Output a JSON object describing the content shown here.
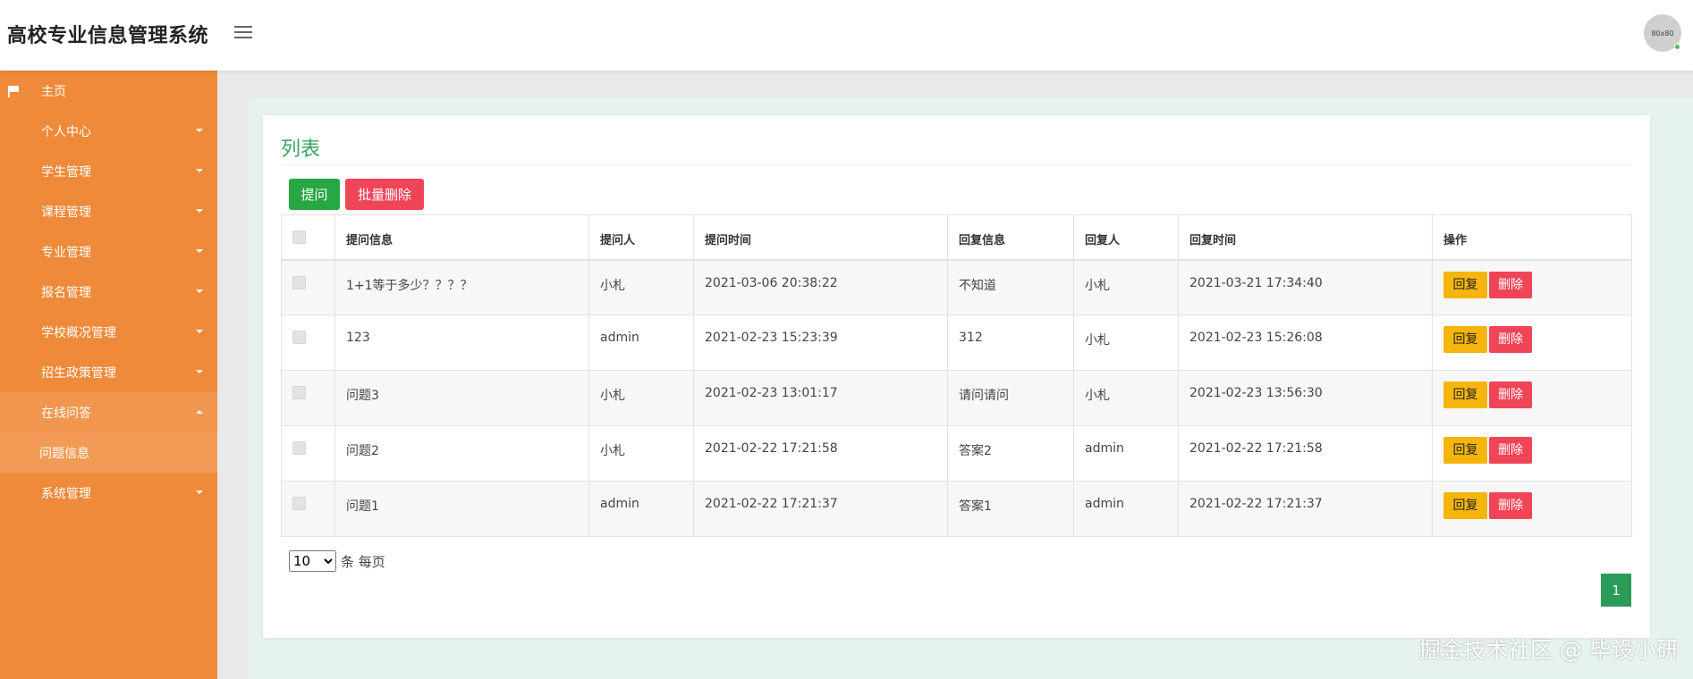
{
  "app": {
    "title": "高校专业信息管理系统",
    "avatar_text": "80x80"
  },
  "sidebar": {
    "items": [
      {
        "label": "主页",
        "icon": "flag-icon",
        "caret": ""
      },
      {
        "label": "个人中心",
        "icon": "grid-icon",
        "caret": "down"
      },
      {
        "label": "学生管理",
        "icon": "grid-icon",
        "caret": "down"
      },
      {
        "label": "课程管理",
        "icon": "grid-icon",
        "caret": "down"
      },
      {
        "label": "专业管理",
        "icon": "grid-icon",
        "caret": "down"
      },
      {
        "label": "报名管理",
        "icon": "grid-icon",
        "caret": "down"
      },
      {
        "label": "学校概况管理",
        "icon": "grid-icon",
        "caret": "down"
      },
      {
        "label": "招生政策管理",
        "icon": "grid-icon",
        "caret": "down"
      },
      {
        "label": "在线问答",
        "icon": "grid-icon",
        "caret": "up",
        "active": true
      },
      {
        "label": "系统管理",
        "icon": "grid-icon",
        "caret": "down"
      }
    ],
    "submenu": {
      "label": "问题信息"
    }
  },
  "main": {
    "title": "列表",
    "buttons": {
      "ask": "提问",
      "batch_delete": "批量删除"
    },
    "table": {
      "headers": [
        "提问信息",
        "提问人",
        "提问时间",
        "回复信息",
        "回复人",
        "回复时间",
        "操作"
      ],
      "rows": [
        {
          "question": "1+1等于多少？？？？",
          "asker": "小札",
          "ask_time": "2021-03-06 20:38:22",
          "reply": "不知道",
          "replier": "小札",
          "reply_time": "2021-03-21 17:34:40"
        },
        {
          "question": "123",
          "asker": "admin",
          "ask_time": "2021-02-23 15:23:39",
          "reply": "312",
          "replier": "小札",
          "reply_time": "2021-02-23 15:26:08"
        },
        {
          "question": "问题3",
          "asker": "小札",
          "ask_time": "2021-02-23 13:01:17",
          "reply": "请问请问",
          "replier": "小札",
          "reply_time": "2021-02-23 13:56:30"
        },
        {
          "question": "问题2",
          "asker": "小札",
          "ask_time": "2021-02-22 17:21:58",
          "reply": "答案2",
          "replier": "admin",
          "reply_time": "2021-02-22 17:21:58"
        },
        {
          "question": "问题1",
          "asker": "admin",
          "ask_time": "2021-02-22 17:21:37",
          "reply": "答案1",
          "replier": "admin",
          "reply_time": "2021-02-22 17:21:37"
        }
      ],
      "actions": {
        "reply": "回复",
        "delete": "删除"
      }
    },
    "pagination": {
      "page_size": "10",
      "per_page_text": "条 每页",
      "current_page": "1"
    }
  },
  "watermark": "掘金技术社区 @ 毕设小研",
  "colors": {
    "sidebar": "#ee8a3a",
    "accent": "#3aa360",
    "danger": "#f04556",
    "warning": "#f5b50c"
  }
}
